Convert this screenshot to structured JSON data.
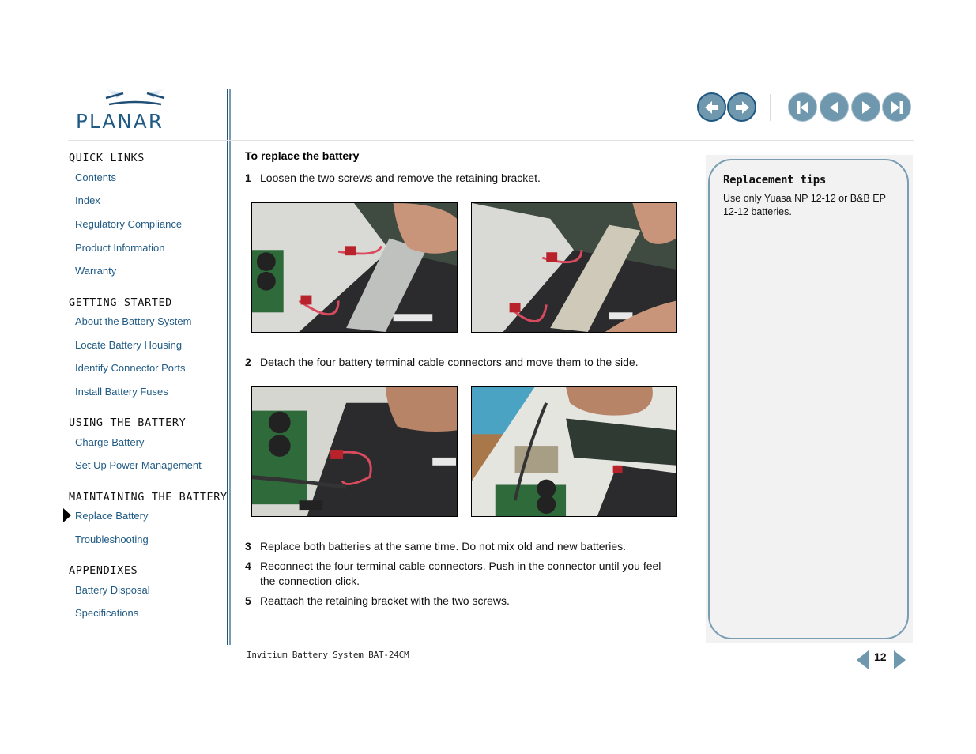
{
  "brand": {
    "logo_text": "PLANAR",
    "accent": "#1f5a84",
    "button_color": "#6f97ae"
  },
  "toolbar": {
    "history_back": "back-icon",
    "history_forward": "forward-icon",
    "first_page": "first-page-icon",
    "prev_page": "previous-page-icon",
    "next_page": "next-page-icon",
    "last_page": "last-page-icon"
  },
  "sidebar": {
    "sections": [
      {
        "title": "QUICK LINKS",
        "items": [
          "Contents",
          "Index",
          "Regulatory Compliance",
          "Product Information",
          "Warranty"
        ]
      },
      {
        "title": "GETTING STARTED",
        "items": [
          "About the Battery System",
          "Locate Battery Housing",
          "Identify Connector Ports",
          "Install Battery Fuses"
        ]
      },
      {
        "title": "USING THE BATTERY",
        "items": [
          "Charge Battery",
          "Set Up Power Management"
        ]
      },
      {
        "title": "MAINTAINING THE BATTERY",
        "items": [
          "Replace Battery",
          "Troubleshooting"
        ]
      },
      {
        "title": "APPENDIXES",
        "items": [
          "Battery Disposal",
          "Specifications"
        ]
      }
    ],
    "current_item": "Replace Battery"
  },
  "main": {
    "procedure_title": "To replace the battery",
    "steps": [
      {
        "num": "1",
        "text": "Loosen the two screws and remove the retaining bracket."
      },
      {
        "num": "2",
        "text": "Detach the four battery terminal cable connectors and move them to the side."
      },
      {
        "num": "3",
        "text": "Replace both batteries at the same time. Do not mix old and new batteries."
      },
      {
        "num": "4",
        "text": "Reconnect the four terminal cable connectors. Push in the connector until you feel the connection click."
      },
      {
        "num": "5",
        "text": "Reattach the retaining bracket with the two screws."
      }
    ],
    "photos": [
      "Hand lifting retaining bracket off battery",
      "Retaining bracket removed, held above battery",
      "Hand detaching battery terminal connector",
      "Connectors moved aside inside battery housing"
    ]
  },
  "tips": {
    "title": "Replacement tips",
    "body": "Use only Yuasa NP 12-12 or B&B EP 12-12 batteries."
  },
  "footer": {
    "doc_title": "Invitium Battery System BAT-24CM",
    "page_number": "12"
  }
}
